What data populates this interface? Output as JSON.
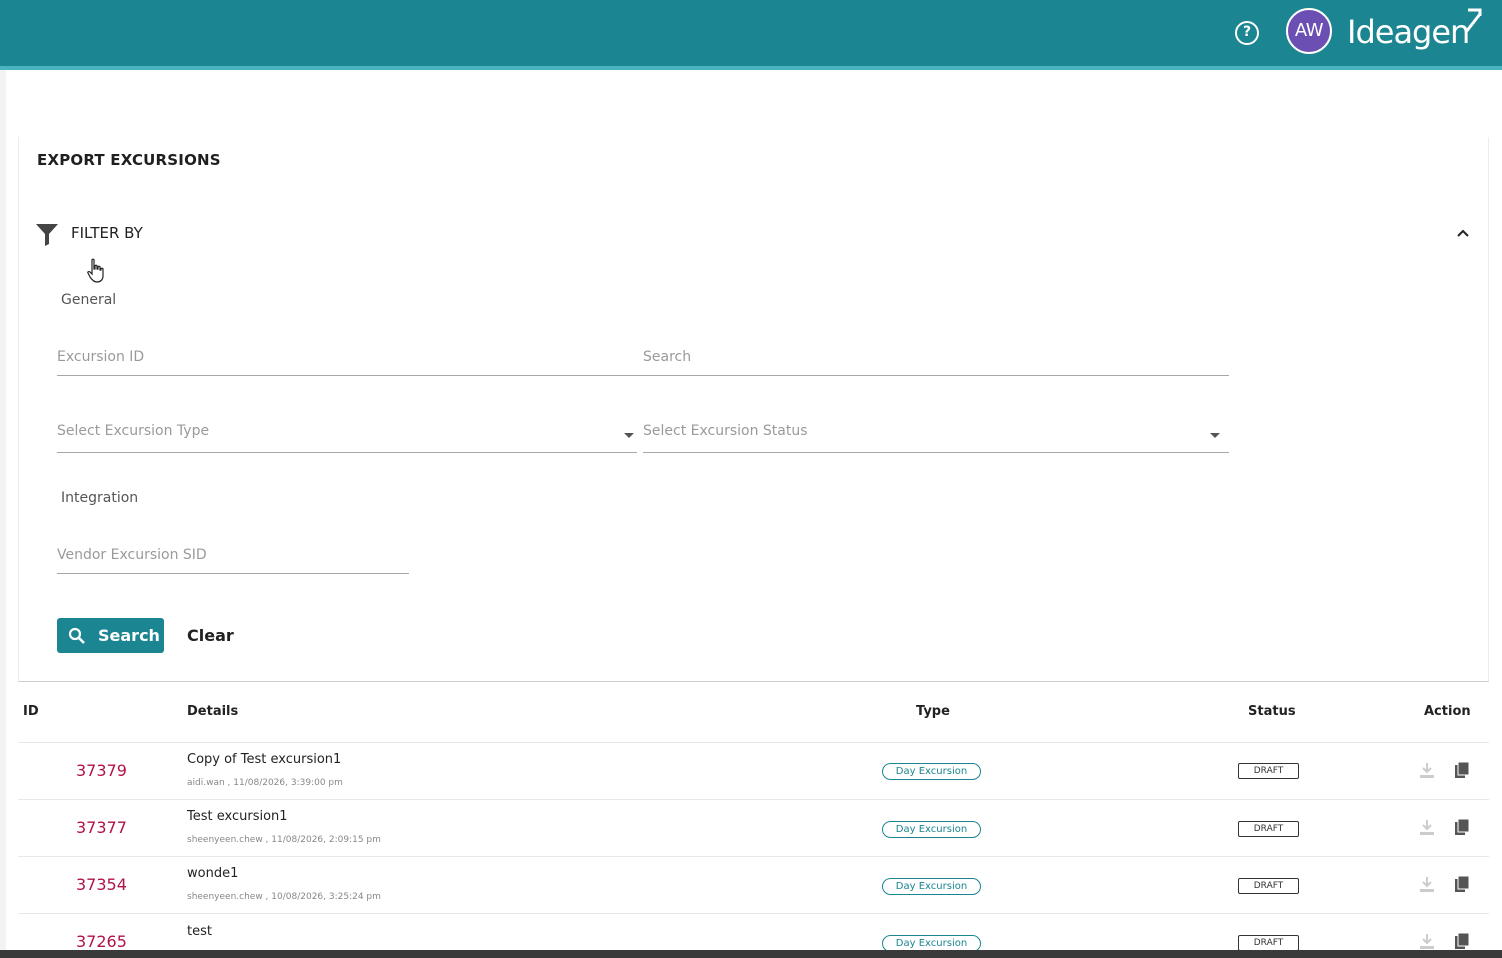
{
  "header": {
    "help_icon": "help-circle-icon",
    "avatar_initials": "AW",
    "brand": "Ideagen",
    "brand_color": "#1b8591",
    "avatar_color": "#6c4fb3"
  },
  "page": {
    "title": "EXPORT EXCURSIONS",
    "filter_label": "FILTER BY"
  },
  "filters": {
    "general_label": "General",
    "excursion_id_placeholder": "Excursion ID",
    "search_placeholder": "Search",
    "type_placeholder": "Select Excursion Type",
    "status_placeholder": "Select Excursion Status",
    "integration_label": "Integration",
    "vendor_sid_placeholder": "Vendor Excursion SID",
    "search_button": "Search",
    "clear_button": "Clear"
  },
  "table": {
    "headers": {
      "id": "ID",
      "details": "Details",
      "type": "Type",
      "status": "Status",
      "action": "Action"
    },
    "rows": [
      {
        "id": "37379",
        "title": "Copy of Test excursion1",
        "meta": "aidi.wan , 11/08/2026, 3:39:00 pm",
        "type": "Day Excursion",
        "status": "DRAFT"
      },
      {
        "id": "37377",
        "title": "Test excursion1",
        "meta": "sheenyeen.chew , 11/08/2026, 2:09:15 pm",
        "type": "Day Excursion",
        "status": "DRAFT"
      },
      {
        "id": "37354",
        "title": "wonde1",
        "meta": "sheenyeen.chew , 10/08/2026, 3:25:24 pm",
        "type": "Day Excursion",
        "status": "DRAFT"
      },
      {
        "id": "37265",
        "title": "test",
        "meta": "",
        "type": "Day Excursion",
        "status": "DRAFT"
      }
    ]
  }
}
